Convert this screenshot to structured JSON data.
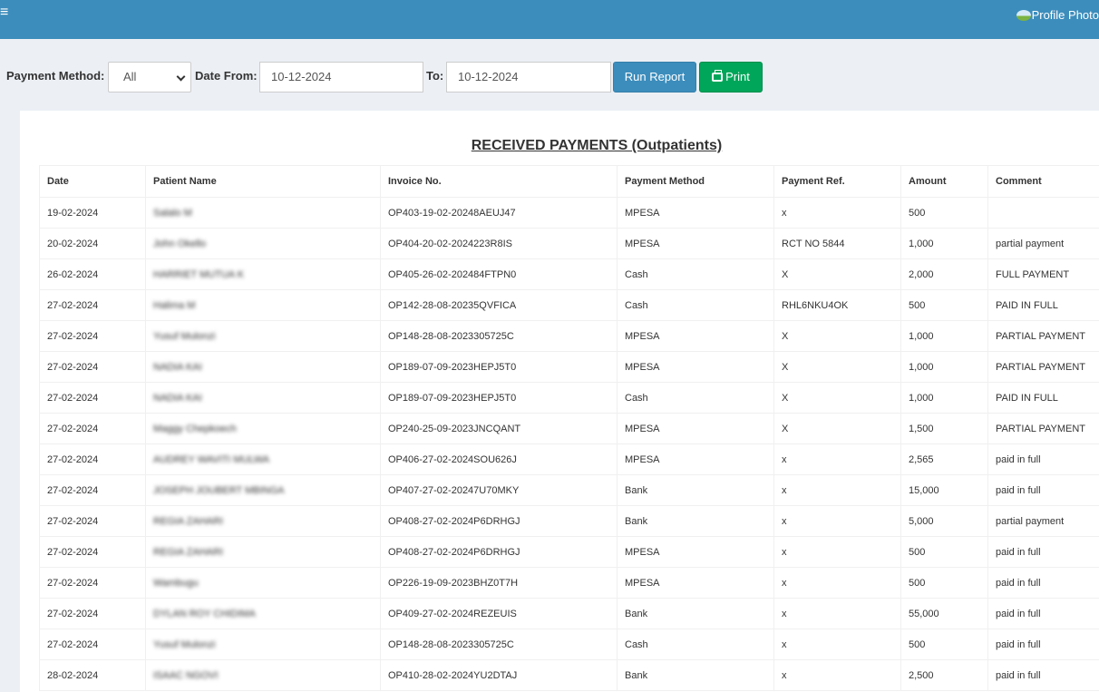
{
  "header": {
    "menu_icon": "hamburger-icon",
    "profile_label": "Profile Photo"
  },
  "filters": {
    "payment_method_label": "Payment Method:",
    "payment_method_value": "All",
    "date_from_label": "Date From:",
    "date_from_value": "10-12-2024",
    "to_label": "To:",
    "to_value": "10-12-2024",
    "run_report_label": "Run Report",
    "print_label": "Print"
  },
  "report": {
    "title": "RECEIVED PAYMENTS (Outpatients)",
    "columns": [
      "Date",
      "Patient Name",
      "Invoice No.",
      "Payment Method",
      "Payment Ref.",
      "Amount",
      "Comment"
    ],
    "rows": [
      [
        "19-02-2024",
        "Salalo M",
        "OP403-19-02-20248AEUJ47",
        "MPESA",
        "x",
        "500",
        ""
      ],
      [
        "20-02-2024",
        "John Okello",
        "OP404-20-02-2024223R8IS",
        "MPESA",
        "RCT NO 5844",
        "1,000",
        "partial payment"
      ],
      [
        "26-02-2024",
        "HARRIET MUTUA K",
        "OP405-26-02-202484FTPN0",
        "Cash",
        "X",
        "2,000",
        "FULL PAYMENT"
      ],
      [
        "27-02-2024",
        "Halima M",
        "OP142-28-08-20235QVFICA",
        "Cash",
        "RHL6NKU4OK",
        "500",
        "PAID IN FULL"
      ],
      [
        "27-02-2024",
        "Yusuf Mulonzi",
        "OP148-28-08-2023305725C",
        "MPESA",
        "X",
        "1,000",
        "PARTIAL PAYMENT"
      ],
      [
        "27-02-2024",
        "NADIA KAI",
        "OP189-07-09-2023HEPJ5T0",
        "MPESA",
        "X",
        "1,000",
        "PARTIAL PAYMENT"
      ],
      [
        "27-02-2024",
        "NADIA KAI",
        "OP189-07-09-2023HEPJ5T0",
        "Cash",
        "X",
        "1,000",
        "PAID IN FULL"
      ],
      [
        "27-02-2024",
        "Maggy Chepkoech",
        "OP240-25-09-2023JNCQANT",
        "MPESA",
        "X",
        "1,500",
        "PARTIAL PAYMENT"
      ],
      [
        "27-02-2024",
        "AUDREY WAVITI MULWA",
        "OP406-27-02-2024SOU626J",
        "MPESA",
        "x",
        "2,565",
        "paid in full"
      ],
      [
        "27-02-2024",
        "JOSEPH JOUBERT MBINGA",
        "OP407-27-02-20247U70MKY",
        "Bank",
        "x",
        "15,000",
        "paid in full"
      ],
      [
        "27-02-2024",
        "REGIA ZAHARI",
        "OP408-27-02-2024P6DRHGJ",
        "Bank",
        "x",
        "5,000",
        "partial payment"
      ],
      [
        "27-02-2024",
        "REGIA ZAHARI",
        "OP408-27-02-2024P6DRHGJ",
        "MPESA",
        "x",
        "500",
        "paid in full"
      ],
      [
        "27-02-2024",
        "Wambugu",
        "OP226-19-09-2023BHZ0T7H",
        "MPESA",
        "x",
        "500",
        "paid in full"
      ],
      [
        "27-02-2024",
        "DYLAN ROY CHIDIMA",
        "OP409-27-02-2024REZEUIS",
        "Bank",
        "x",
        "55,000",
        "paid in full"
      ],
      [
        "27-02-2024",
        "Yusuf Mulonzi",
        "OP148-28-08-2023305725C",
        "Cash",
        "x",
        "500",
        "paid in full"
      ],
      [
        "28-02-2024",
        "ISAAC NGOVI",
        "OP410-28-02-2024YU2DTAJ",
        "Bank",
        "x",
        "2,500",
        "paid in full"
      ]
    ]
  }
}
